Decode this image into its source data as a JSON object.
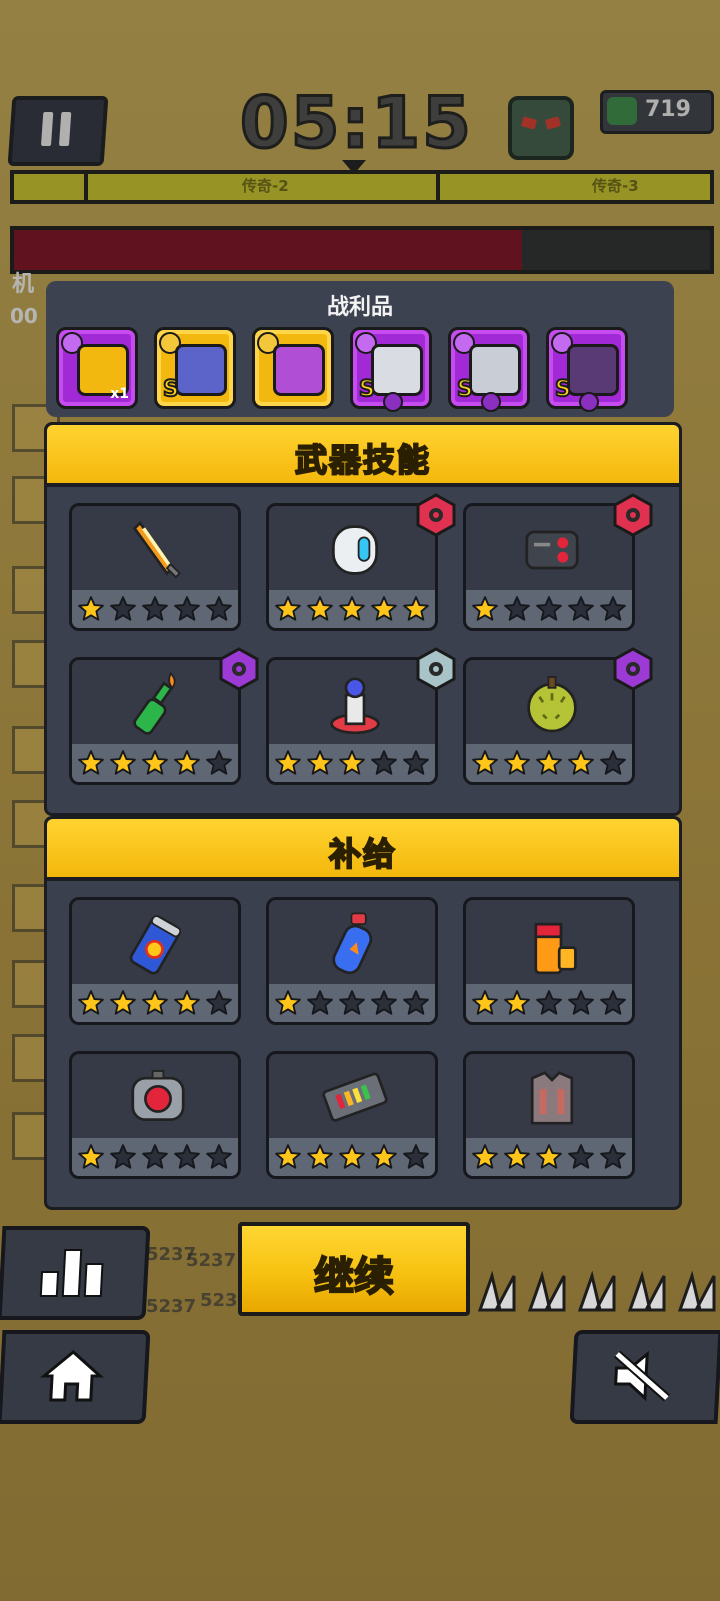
{
  "hud": {
    "timer": "05:15",
    "coins": "719",
    "stage_left": "传奇-2",
    "stage_right": "传奇-3",
    "hp_fraction": 0.73,
    "player_label_partial": "机",
    "level_partial": "00"
  },
  "loot": {
    "title": "战利品",
    "items": [
      {
        "rarity": "purple",
        "icon": "upgrade-card-icon",
        "qty": "x1"
      },
      {
        "rarity": "gold",
        "icon": "weapon-blaster-icon",
        "grade": "S"
      },
      {
        "rarity": "gold",
        "icon": "boots-icon"
      },
      {
        "rarity": "purple",
        "icon": "armor-glove-icon",
        "grade": "S"
      },
      {
        "rarity": "purple",
        "icon": "mech-arm-icon",
        "grade": "S"
      },
      {
        "rarity": "purple",
        "icon": "drill-core-icon",
        "grade": "S"
      }
    ]
  },
  "weapons": {
    "title": "武器技能",
    "cards": [
      {
        "icon": "flame-sword-icon",
        "stars": 1,
        "badge": null
      },
      {
        "icon": "capsule-drone-icon",
        "stars": 5,
        "badge": "red"
      },
      {
        "icon": "laser-cannon-icon",
        "stars": 1,
        "badge": "red"
      },
      {
        "icon": "molotov-bottle-icon",
        "stars": 4,
        "badge": "purple"
      },
      {
        "icon": "tesla-tower-icon",
        "stars": 3,
        "badge": "teal"
      },
      {
        "icon": "durian-icon",
        "stars": 4,
        "badge": "purple"
      }
    ]
  },
  "supplies": {
    "title": "补给",
    "cards": [
      {
        "icon": "energy-can-icon",
        "stars": 4
      },
      {
        "icon": "fuel-bottle-icon",
        "stars": 1
      },
      {
        "icon": "battery-icon",
        "stars": 2
      },
      {
        "icon": "power-core-icon",
        "stars": 1
      },
      {
        "icon": "energy-cell-icon",
        "stars": 4
      },
      {
        "icon": "vest-armor-icon",
        "stars": 3
      }
    ]
  },
  "buttons": {
    "continue": "继续"
  },
  "colors": {
    "star_on": "#ffc619",
    "star_off": "#2a2f3a",
    "section_head": "#f8c21c",
    "panel": "#3a404d",
    "badge_red": "#e03150",
    "badge_purple": "#9b3ad4",
    "badge_teal": "#a9c4c8"
  },
  "background_damage_numbers": [
    "5237",
    "5237",
    "5237",
    "523",
    "523"
  ]
}
